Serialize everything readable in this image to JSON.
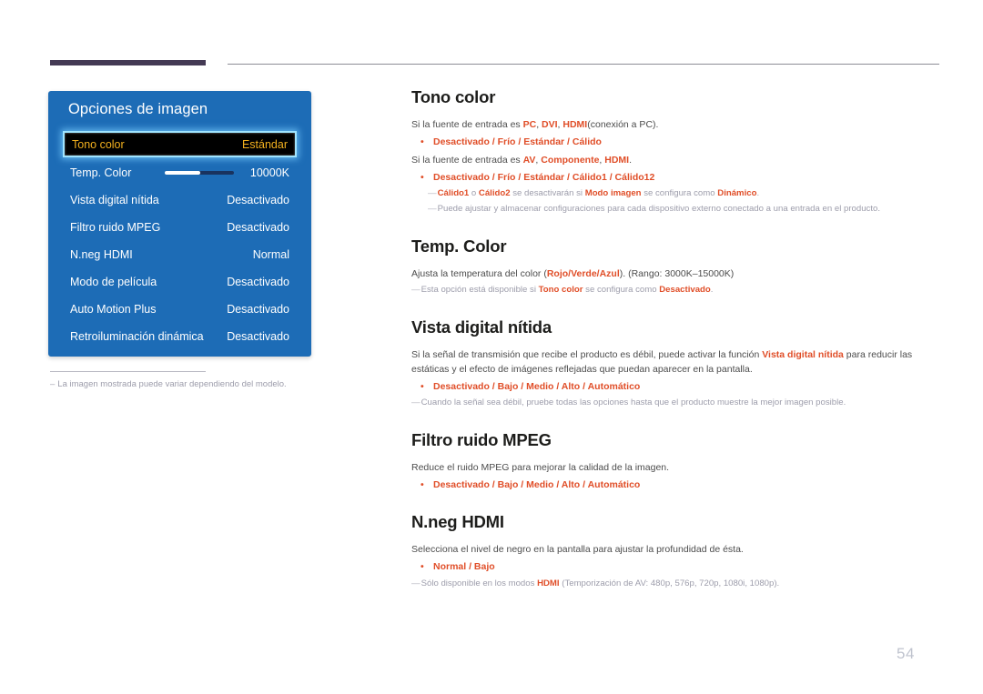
{
  "page": {
    "number": "54",
    "accent_purple": "#443a54",
    "accent_orange": "#e04e28",
    "osd_blue": "#1d6cb6",
    "osd_highlight_text": "#f2b01e"
  },
  "osd": {
    "title": "Opciones de imagen",
    "rows": [
      {
        "label": "Tono color",
        "value": "Estándar",
        "selected": true,
        "slider": false
      },
      {
        "label": "Temp. Color",
        "value": "10000K",
        "selected": false,
        "slider": true
      },
      {
        "label": "Vista digital nítida",
        "value": "Desactivado",
        "selected": false,
        "slider": false
      },
      {
        "label": "Filtro ruido MPEG",
        "value": "Desactivado",
        "selected": false,
        "slider": false
      },
      {
        "label": "N.neg HDMI",
        "value": "Normal",
        "selected": false,
        "slider": false
      },
      {
        "label": "Modo de película",
        "value": "Desactivado",
        "selected": false,
        "slider": false
      },
      {
        "label": "Auto Motion Plus",
        "value": "Desactivado",
        "selected": false,
        "slider": false
      },
      {
        "label": "Retroiluminación dinámica",
        "value": "Desactivado",
        "selected": false,
        "slider": false
      }
    ],
    "footnote_dash": "–",
    "footnote": "La imagen mostrada puede variar dependiendo del modelo."
  },
  "sections": {
    "tono_color": {
      "heading": "Tono color",
      "p1_a": "Si la fuente de entrada es ",
      "p1_b": "PC",
      "p1_c": ", ",
      "p1_d": "DVI",
      "p1_e": ", ",
      "p1_f": "HDMI",
      "p1_g": "(conexión a PC).",
      "bullet1_dot": "•",
      "bullet1": "Desactivado / Frío / Estándar / Cálido",
      "p2_a": "Si la fuente de entrada es ",
      "p2_b": "AV",
      "p2_c": ", ",
      "p2_d": "Componente",
      "p2_e": ", ",
      "p2_f": "HDMI",
      "p2_g": ".",
      "bullet2_dot": "•",
      "bullet2": "Desactivado / Frío / Estándar / Cálido1 / Cálido12",
      "note1_dash": "—",
      "note1_a": "Cálido1",
      "note1_b": " o ",
      "note1_c": "Cálido2",
      "note1_d": " se desactivarán si ",
      "note1_e": "Modo imagen",
      "note1_f": " se configura como ",
      "note1_g": "Dinámico",
      "note1_h": ".",
      "note2_dash": "—",
      "note2": "Puede ajustar y almacenar configuraciones para cada dispositivo externo conectado a una entrada en el producto."
    },
    "temp_color": {
      "heading": "Temp. Color",
      "p1_a": "Ajusta la temperatura del color (",
      "p1_b": "Rojo/Verde/Azul",
      "p1_c": "). (Rango: 3000K–15000K)",
      "note_dash": "—",
      "note_a": "Esta opción está disponible si ",
      "note_b": "Tono color",
      "note_c": " se configura como ",
      "note_d": "Desactivado",
      "note_e": "."
    },
    "vista_digital": {
      "heading": "Vista digital nítida",
      "p1_a": "Si la señal de transmisión que recibe el producto es débil, puede activar la función ",
      "p1_b": "Vista digital nítida",
      "p1_c": " para reducir las estáticas y el efecto de imágenes reflejadas que puedan aparecer en la pantalla.",
      "bullet_dot": "•",
      "bullet": "Desactivado / Bajo / Medio / Alto / Automático",
      "note_dash": "—",
      "note": "Cuando la señal sea débil, pruebe todas las opciones hasta que el producto muestre la mejor imagen posible."
    },
    "filtro_mpeg": {
      "heading": "Filtro ruido MPEG",
      "p1": "Reduce el ruido MPEG para mejorar la calidad de la imagen.",
      "bullet_dot": "•",
      "bullet": "Desactivado / Bajo / Medio / Alto / Automático"
    },
    "nneg_hdmi": {
      "heading": "N.neg HDMI",
      "p1": "Selecciona el nivel de negro en la pantalla para ajustar la profundidad de ésta.",
      "bullet_dot": "•",
      "bullet": "Normal / Bajo",
      "note_dash": "—",
      "note_a": "Sólo disponible en los modos ",
      "note_b": "HDMI",
      "note_c": " (Temporización de AV: 480p, 576p, 720p, 1080i, 1080p)."
    }
  }
}
